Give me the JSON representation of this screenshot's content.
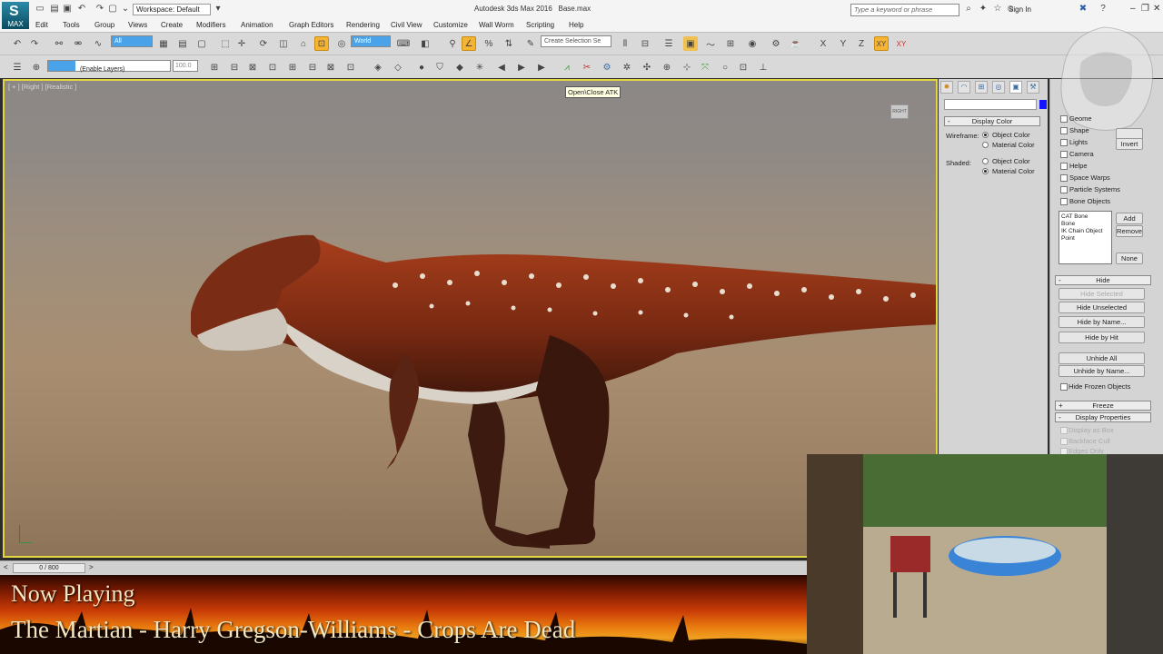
{
  "app": {
    "logo_label": "MAX",
    "workspace": "Workspace: Default",
    "title": "Autodesk 3ds Max 2016",
    "file": "Base.max",
    "search_placeholder": "Type a keyword or phrase",
    "signin": "Sign In"
  },
  "menu": [
    "Edit",
    "Tools",
    "Group",
    "Views",
    "Create",
    "Modifiers",
    "Animation",
    "Graph Editors",
    "Rendering",
    "Civil View",
    "Customize",
    "Wall Worm",
    "Scripting",
    "Help"
  ],
  "toolbar": {
    "selection_filter": "All",
    "ref_coord": "World",
    "selection_set": "Create Selection Se",
    "axis_x": "X",
    "axis_y": "Y",
    "axis_z": "Z",
    "axis_xy": "XY",
    "axis_xy2": "XY"
  },
  "layer_toolbar": {
    "layers": "(Enable Layers)",
    "percent": "100.0"
  },
  "tooltip": "Open\\Close ATK",
  "viewport": {
    "label": "[ + ] [Right ] [Realistic ]",
    "viewcube": "RIGHT"
  },
  "timeline": {
    "frame": "0 / 800"
  },
  "command_panel": {
    "display_color_title": "Display Color",
    "wireframe_label": "Wireframe:",
    "shaded_label": "Shaded:",
    "object_color": "Object Color",
    "material_color": "Material Color",
    "wireframe_selected": "Object Color",
    "shaded_selected": "Material Color"
  },
  "display_panel": {
    "hide_by_category": [
      {
        "label": "Geome"
      },
      {
        "label": "Shape"
      },
      {
        "label": "Lights"
      },
      {
        "label": "Camera"
      },
      {
        "label": "Helpe"
      },
      {
        "label": "Space Warps"
      },
      {
        "label": "Particle Systems"
      },
      {
        "label": "Bone Objects"
      }
    ],
    "invert": "Invert",
    "list_items": [
      "CAT Bone",
      "Bone",
      "IK Chain Object",
      "Point"
    ],
    "add": "Add",
    "remove": "Remove",
    "none": "None",
    "hide_title": "Hide",
    "hide_selected": "Hide Selected",
    "hide_unselected": "Hide Unselected",
    "hide_by_name": "Hide by Name...",
    "hide_by_hit": "Hide by Hit",
    "unhide_all": "Unhide All",
    "unhide_by_name": "Unhide by Name...",
    "hide_frozen": "Hide Frozen Objects",
    "freeze_title": "Freeze",
    "display_props_title": "Display Properties",
    "display_as_box": "Display as Box",
    "backface_cull": "Backface Cull",
    "edges_only": "Edges Only"
  },
  "now_playing": {
    "heading": "Now Playing",
    "track": "The Martian - Harry Gregson-Williams - Crops Are Dead"
  }
}
